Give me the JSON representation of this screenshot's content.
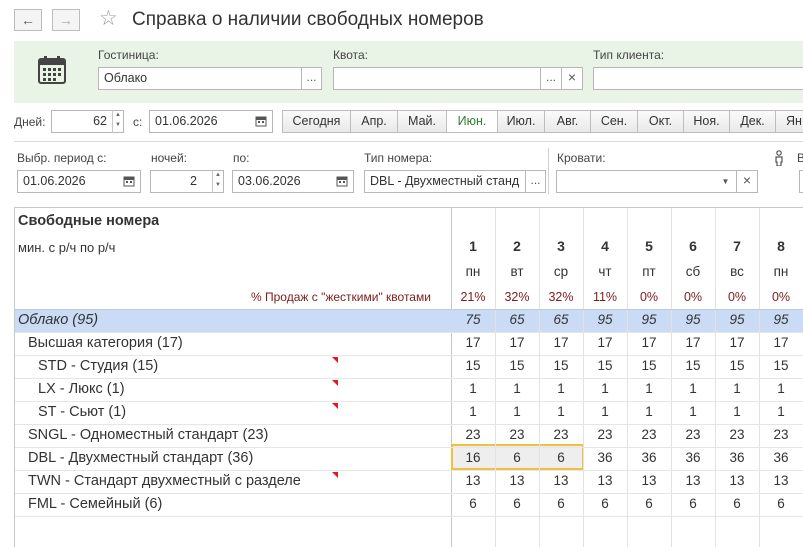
{
  "window": {
    "title": "Справка о наличии свободных номеров",
    "back_icon": "←",
    "forward_icon": "→",
    "star_icon": "☆"
  },
  "filters": {
    "hotel_label": "Гостиница:",
    "hotel_value": "Облако",
    "quota_label": "Квота:",
    "quota_value": "",
    "client_type_label": "Тип клиента:",
    "client_type_value": "",
    "ellipsis": "...",
    "clear": "×"
  },
  "period": {
    "days_label": "Дней:",
    "days_value": "62",
    "from_label": "с:",
    "from_value": "01.06.2026",
    "buttons": [
      "Сегодня",
      "Апр.",
      "Май.",
      "Июн.",
      "Июл.",
      "Авг.",
      "Сен.",
      "Окт.",
      "Ноя.",
      "Дек.",
      "Ян"
    ],
    "active_button": "Июн."
  },
  "selection": {
    "period_label": "Выбр. период с:",
    "period_value": "01.06.2026",
    "nights_label": "ночей:",
    "nights_value": "2",
    "to_label": "по:",
    "to_value": "03.06.2026",
    "room_type_label": "Тип номера:",
    "room_type_value": "DBL - Двухместный станд",
    "beds_label": "Кровати:",
    "beds_value": "",
    "extra_label": "В"
  },
  "table": {
    "title": "Свободные номера",
    "subtitle": "мин. с р/ч по р/ч",
    "sales_label": "% Продаж с \"жесткими\" квотами",
    "days": [
      {
        "num": "1",
        "dow": "пн",
        "pct": "21%"
      },
      {
        "num": "2",
        "dow": "вт",
        "pct": "32%"
      },
      {
        "num": "3",
        "dow": "ср",
        "pct": "32%"
      },
      {
        "num": "4",
        "dow": "чт",
        "pct": "11%"
      },
      {
        "num": "5",
        "dow": "пт",
        "pct": "0%"
      },
      {
        "num": "6",
        "dow": "сб",
        "pct": "0%"
      },
      {
        "num": "7",
        "dow": "вс",
        "pct": "0%"
      },
      {
        "num": "8",
        "dow": "пн",
        "pct": "0%"
      }
    ],
    "rows": [
      {
        "label": "Облако (95)",
        "values": [
          "75",
          "65",
          "65",
          "95",
          "95",
          "95",
          "95",
          "95"
        ]
      },
      {
        "label": "Высшая категория (17)",
        "values": [
          "17",
          "17",
          "17",
          "17",
          "17",
          "17",
          "17",
          "17"
        ]
      },
      {
        "label": "STD - Студия (15)",
        "values": [
          "15",
          "15",
          "15",
          "15",
          "15",
          "15",
          "15",
          "15"
        ]
      },
      {
        "label": "LX - Люкс (1)",
        "values": [
          "1",
          "1",
          "1",
          "1",
          "1",
          "1",
          "1",
          "1"
        ]
      },
      {
        "label": "ST - Сьют (1)",
        "values": [
          "1",
          "1",
          "1",
          "1",
          "1",
          "1",
          "1",
          "1"
        ]
      },
      {
        "label": "SNGL - Одноместный стандарт (23)",
        "values": [
          "23",
          "23",
          "23",
          "23",
          "23",
          "23",
          "23",
          "23"
        ]
      },
      {
        "label": "DBL - Двухместный стандарт (36)",
        "values": [
          "16",
          "6",
          "6",
          "36",
          "36",
          "36",
          "36",
          "36"
        ]
      },
      {
        "label": "TWN - Стандарт двухместный с разделе",
        "values": [
          "13",
          "13",
          "13",
          "13",
          "13",
          "13",
          "13",
          "13"
        ]
      },
      {
        "label": "FML - Семейный (6)",
        "values": [
          "6",
          "6",
          "6",
          "6",
          "6",
          "6",
          "6",
          "6"
        ]
      }
    ]
  },
  "colors": {
    "filter_panel": "#eaf4e6",
    "hotel_row": "#c9dbf5",
    "selection_border": "#f0c040",
    "pct_text": "#7a1c1c",
    "marker": "#e01b1b",
    "active_month": "#2e7d32"
  }
}
